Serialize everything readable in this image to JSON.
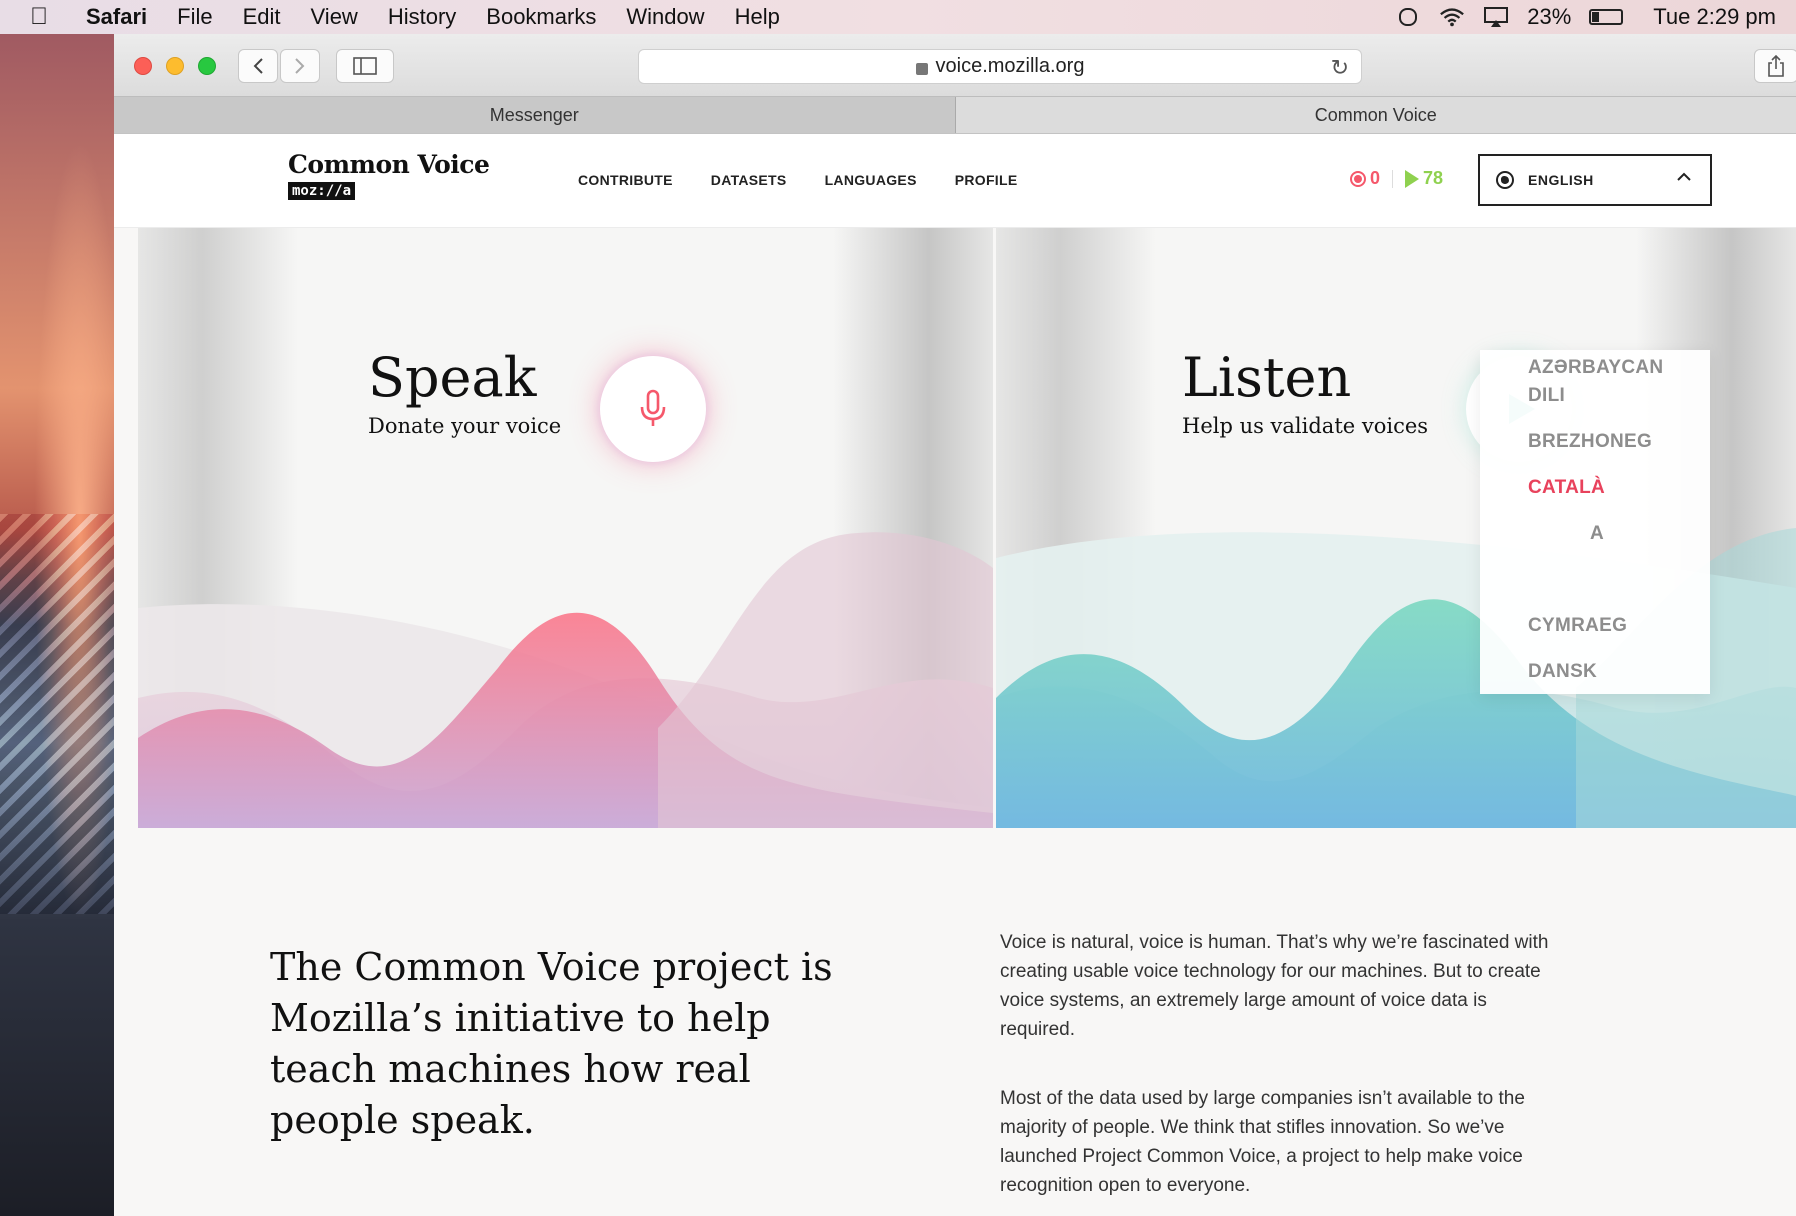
{
  "menubar": {
    "app": "Safari",
    "items": [
      "File",
      "Edit",
      "View",
      "History",
      "Bookmarks",
      "Window",
      "Help"
    ],
    "battery": "23%",
    "clock": "Tue 2:29 pm"
  },
  "browser": {
    "url": "voice.mozilla.org",
    "tabs": [
      {
        "label": "Messenger",
        "active": false
      },
      {
        "label": "Common Voice",
        "active": true
      }
    ]
  },
  "site": {
    "logo_title": "Common Voice",
    "logo_sub": "moz://a",
    "nav": [
      "CONTRIBUTE",
      "DATASETS",
      "LANGUAGES",
      "PROFILE"
    ],
    "recorded_count": "0",
    "validated_count": "78",
    "language_label": "ENGLISH"
  },
  "dropdown": {
    "items": [
      "AZƏRBAYCAN DILI",
      "BREZHONEG",
      "CATALÀ",
      "A",
      "",
      "CYMRAEG",
      "DANSK"
    ],
    "selected": "CATALÀ"
  },
  "speak": {
    "title": "Speak",
    "subtitle": "Donate your voice"
  },
  "listen": {
    "title": "Listen",
    "subtitle": "Help us validate voices"
  },
  "about": {
    "heading": "The Common Voice project is Mozilla’s initiative to help teach machines how real people speak.",
    "p1": "Voice is natural, voice is human. That’s why we’re fascinated with creating usable voice technology for our machines. But to create voice systems, an extremely large amount of voice data is required.",
    "p2": "Most of the data used by large companies isn’t available to the majority of people. We think that stifles innovation. So we’ve launched Project Common Voice, a project to help make voice recognition open to everyone."
  },
  "colors": {
    "record": "#f5586b",
    "validate": "#8fd14f",
    "listen_accent": "#59cbb7",
    "selected_lang": "#e8425c"
  }
}
